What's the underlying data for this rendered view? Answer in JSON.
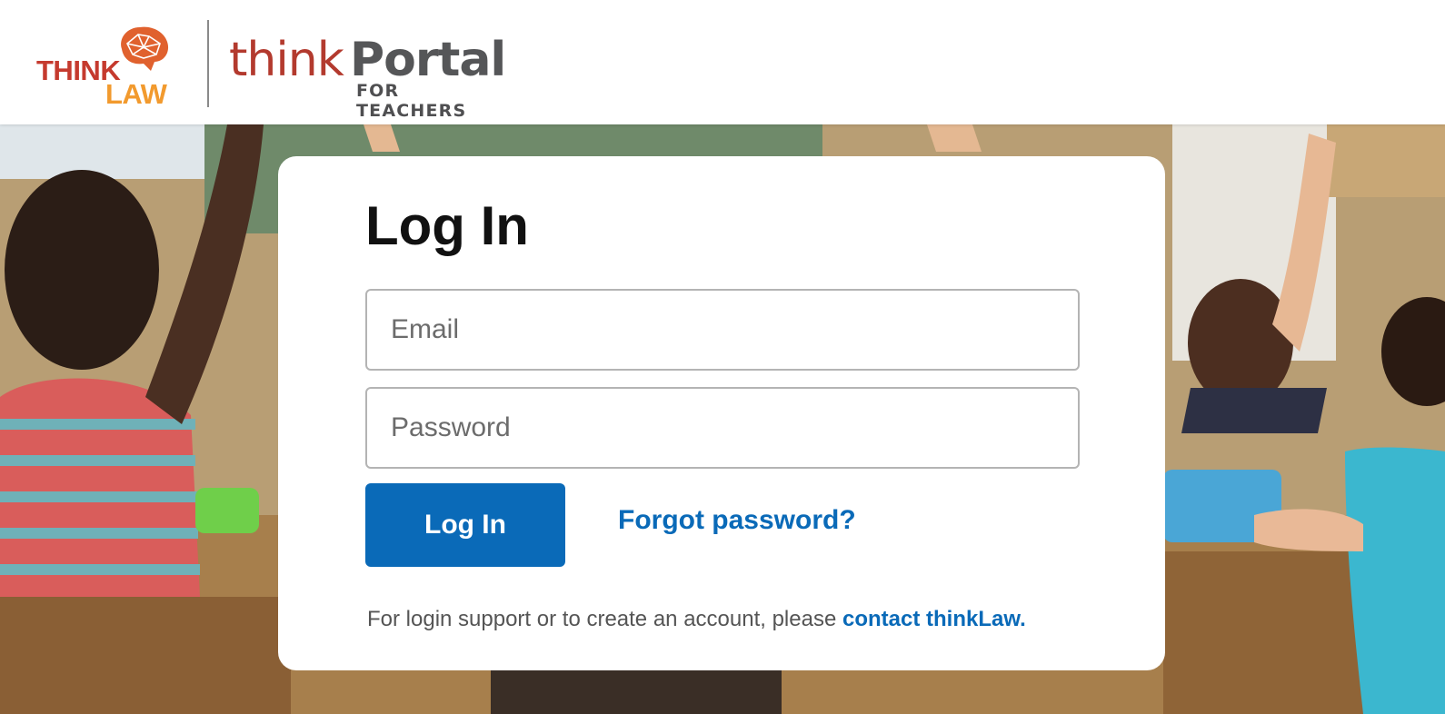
{
  "header": {
    "think_law_logo": {
      "think": "THINK",
      "law": "LAW"
    },
    "portal_logo": {
      "think": "think",
      "portal": "Portal",
      "subtitle": "FOR TEACHERS"
    }
  },
  "login": {
    "title": "Log In",
    "email_placeholder": "Email",
    "password_placeholder": "Password",
    "submit_label": "Log In",
    "forgot_label": "Forgot password?",
    "support_text": "For login support or to create an account, please ",
    "support_link": "contact thinkLaw."
  },
  "colors": {
    "brand_red": "#c53a2e",
    "brand_orange": "#f29a2e",
    "portal_gray": "#555658",
    "primary_blue": "#0a6ab8"
  }
}
